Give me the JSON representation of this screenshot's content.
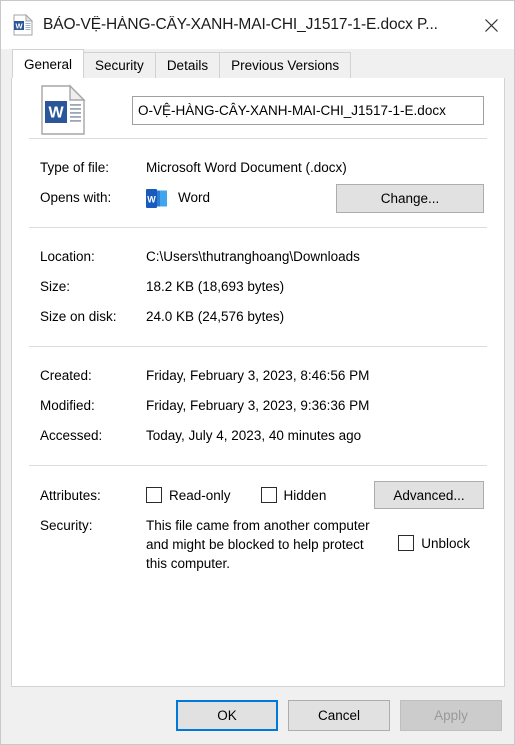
{
  "window": {
    "title": "BẢO-VỆ-HÀNG-CÂY-XANH-MAI-CHI_J1517-1-E.docx P...",
    "icon": "word-document-icon",
    "close_label": "✕"
  },
  "tabs": [
    {
      "label": "General",
      "active": true
    },
    {
      "label": "Security",
      "active": false
    },
    {
      "label": "Details",
      "active": false
    },
    {
      "label": "Previous Versions",
      "active": false
    }
  ],
  "file": {
    "icon": "word-document-icon",
    "name_value": "O-VỆ-HÀNG-CÂY-XANH-MAI-CHI_J1517-1-E.docx",
    "name_placeholder": "File name"
  },
  "properties": {
    "type_label": "Type of file:",
    "type_value": "Microsoft Word Document (.docx)",
    "opens_with_label": "Opens with:",
    "opens_with_value": "Word",
    "opens_with_icon": "word-app-icon",
    "change_button": "Change...",
    "location_label": "Location:",
    "location_value": "C:\\Users\\thutranghoang\\Downloads",
    "size_label": "Size:",
    "size_value": "18.2 KB (18,693 bytes)",
    "size_on_disk_label": "Size on disk:",
    "size_on_disk_value": "24.0 KB (24,576 bytes)",
    "created_label": "Created:",
    "created_value": "Friday, February 3, 2023, 8:46:56 PM",
    "modified_label": "Modified:",
    "modified_value": "Friday, February 3, 2023, 9:36:36 PM",
    "accessed_label": "Accessed:",
    "accessed_value": "Today, July 4, 2023, 40 minutes ago"
  },
  "attributes": {
    "label": "Attributes:",
    "readonly_label": "Read-only",
    "readonly_checked": false,
    "hidden_label": "Hidden",
    "hidden_checked": false,
    "advanced_button": "Advanced..."
  },
  "security": {
    "label": "Security:",
    "message": "This file came from another computer and might be blocked to help protect this computer.",
    "unblock_label": "Unblock",
    "unblock_checked": false
  },
  "footer": {
    "ok_label": "OK",
    "cancel_label": "Cancel",
    "apply_label": "Apply",
    "apply_enabled": false
  },
  "colors": {
    "accent": "#0078d7",
    "word_blue": "#2b579a",
    "dialog_bg": "#f0f0f0",
    "panel_bg": "#ffffff",
    "disabled_text": "#9a9a9a"
  }
}
